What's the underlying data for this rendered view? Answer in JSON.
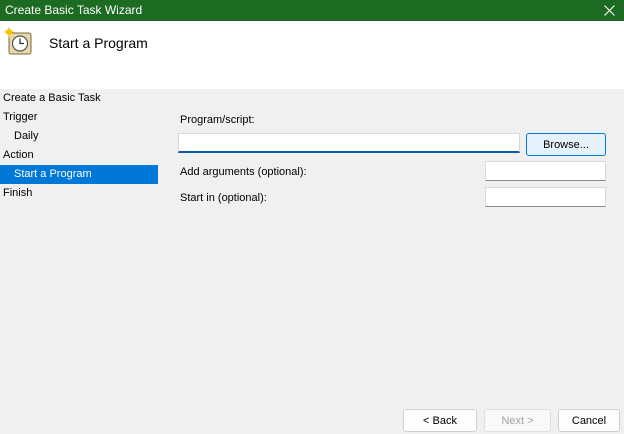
{
  "window": {
    "title": "Create Basic Task Wizard"
  },
  "header": {
    "heading": "Start a Program",
    "icon": "task-clock-icon"
  },
  "sidebar": {
    "items": [
      {
        "label": "Create a Basic Task",
        "sub": false,
        "selected": false
      },
      {
        "label": "Trigger",
        "sub": false,
        "selected": false
      },
      {
        "label": "Daily",
        "sub": true,
        "selected": false
      },
      {
        "label": "Action",
        "sub": false,
        "selected": false
      },
      {
        "label": "Start a Program",
        "sub": true,
        "selected": true
      },
      {
        "label": "Finish",
        "sub": false,
        "selected": false
      }
    ]
  },
  "form": {
    "program_label": "Program/script:",
    "program_value": "",
    "browse_label": "Browse...",
    "arguments_label": "Add arguments (optional):",
    "arguments_value": "",
    "start_in_label": "Start in (optional):",
    "start_in_value": ""
  },
  "footer": {
    "back_label": "< Back",
    "next_label": "Next >",
    "cancel_label": "Cancel"
  },
  "colors": {
    "titlebar": "#1d6b22",
    "selection": "#0078d7",
    "accent_border": "#0a5ba8"
  }
}
